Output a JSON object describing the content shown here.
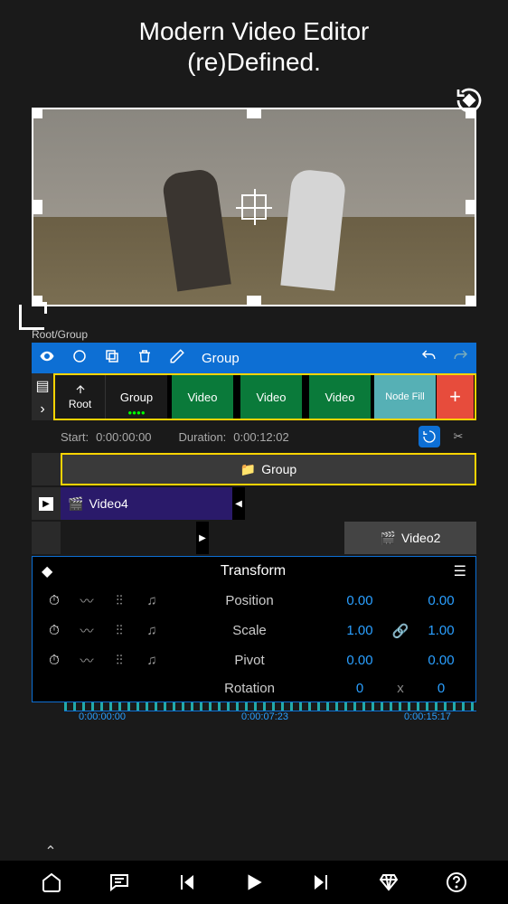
{
  "headline": {
    "line1": "Modern Video Editor",
    "line2": "(re)Defined."
  },
  "breadcrumb": "Root/Group",
  "toolbar": {
    "title": "Group"
  },
  "rootStrip": {
    "root": "Root",
    "clips": [
      "Group",
      "Video",
      "Video",
      "Video",
      "Node Fill"
    ],
    "add": "+"
  },
  "info": {
    "startLabel": "Start:",
    "startValue": "0:00:00:00",
    "durationLabel": "Duration:",
    "durationValue": "0:00:12:02"
  },
  "tracks": {
    "group": "Group",
    "video4": "Video4",
    "video2": "Video2"
  },
  "transform": {
    "title": "Transform",
    "rows": [
      {
        "label": "Position",
        "a": "0.00",
        "mid": "",
        "b": "0.00"
      },
      {
        "label": "Scale",
        "a": "1.00",
        "mid": "link",
        "b": "1.00"
      },
      {
        "label": "Pivot",
        "a": "0.00",
        "mid": "",
        "b": "0.00"
      },
      {
        "label": "Rotation",
        "a": "0",
        "mid": "x",
        "b": "0"
      }
    ]
  },
  "ruler": {
    "t1": "0:00:00:00",
    "t2": "0:00:07:23",
    "t3": "0:00:15:17"
  }
}
